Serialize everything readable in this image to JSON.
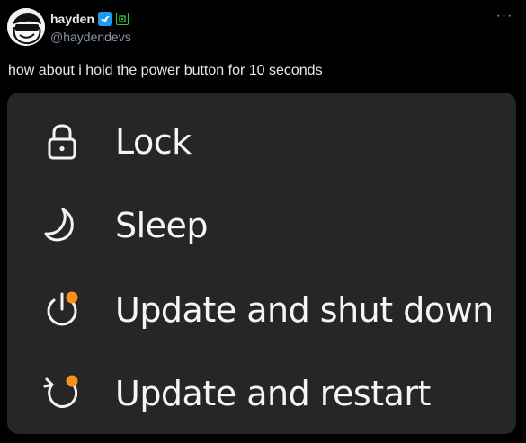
{
  "post": {
    "display_name": "hayden",
    "handle": "@haydendevs",
    "text": "how about i hold the power button for 10 seconds",
    "more_icon": "ellipsis-icon",
    "badges": [
      "verified-badge-icon",
      "square-badge-icon"
    ]
  },
  "media": {
    "menu_items": [
      {
        "icon": "lock-icon",
        "label": "Lock"
      },
      {
        "icon": "sleep-moon-icon",
        "label": "Sleep"
      },
      {
        "icon": "update-shutdown-icon",
        "label": "Update and shut down"
      },
      {
        "icon": "update-restart-icon",
        "label": "Update and restart"
      }
    ]
  },
  "colors": {
    "background": "#000000",
    "menu_background": "#262626",
    "accent_dot": "#f7901e",
    "verified_blue": "#1d9bf0",
    "badge_green": "#27c93f"
  }
}
